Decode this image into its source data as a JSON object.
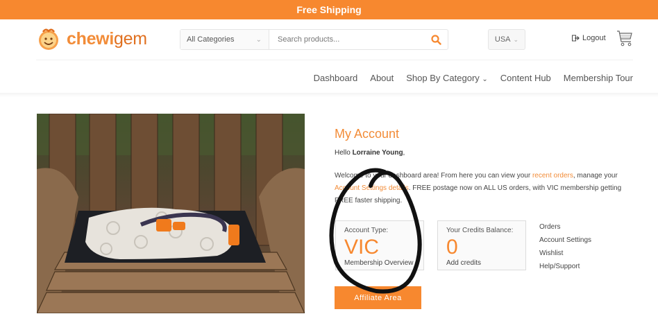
{
  "topbar": {
    "text": "Free Shipping"
  },
  "header": {
    "logo_text_main": "chewi",
    "logo_text_end": "gem",
    "category_select": "All Categories",
    "search_placeholder": "Search products...",
    "country": "USA",
    "logout": "Logout"
  },
  "nav": {
    "items": [
      "Dashboard",
      "About",
      "Shop By Category",
      "Content Hub",
      "Membership Tour"
    ]
  },
  "account": {
    "title": "My Account",
    "hello_prefix": "Hello ",
    "user_name": "Lorraine Young",
    "hello_suffix": ",",
    "welcome_1": "Welcome to your dashboard area! From here you can view your ",
    "recent_orders": "recent orders",
    "welcome_2": ", manage your ",
    "account_details": "Account Settings details",
    "welcome_3": ". FREE postage now on ALL US orders, with VIC membership getting FREE faster shipping.",
    "card_type": {
      "label": "Account Type:",
      "value": "VIC",
      "sub": "Membership Overview"
    },
    "card_credits": {
      "label": "Your Credits Balance:",
      "value": "0",
      "sub": "Add credits"
    },
    "links": [
      "Orders",
      "Account Settings",
      "Wishlist",
      "Help/Support"
    ],
    "affiliate": "Affiliate Area"
  },
  "colors": {
    "accent": "#f7882f",
    "text": "#333333"
  }
}
